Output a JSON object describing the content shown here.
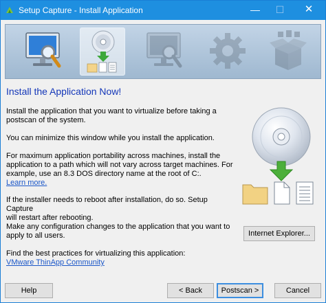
{
  "window": {
    "title": "Setup Capture - Install Application",
    "minimize_glyph": "—",
    "maximize_glyph": "☐",
    "close_glyph": "✕"
  },
  "wizard_steps": [
    {
      "icon": "monitor-search-icon",
      "state": "completed"
    },
    {
      "icon": "install-disc-icon",
      "state": "active"
    },
    {
      "icon": "monitor-search-icon",
      "state": "upcoming"
    },
    {
      "icon": "gear-icon",
      "state": "upcoming"
    },
    {
      "icon": "package-icon",
      "state": "upcoming"
    }
  ],
  "content": {
    "heading": "Install the Application Now!",
    "p1_line1": "Install the application that you want to virtualize before taking a",
    "p1_line2": "postscan of the system.",
    "p2": "You can minimize this window while you install the application.",
    "p3_line1": "For maximum application portability across machines, install the",
    "p3_line2": "application to a path which will not vary across target machines. For",
    "p3_line3": "example, use an 8.3 DOS directory name at the root of C:.",
    "learn_more_link": "Learn more.",
    "p4_line1": "If the installer needs to reboot after installation, do so. Setup Capture",
    "p4_line2": "will restart after rebooting.",
    "p5_line1": "Make any configuration changes to the application that you want to",
    "p5_line2": "apply to all users.",
    "p6": "Find the best practices for virtualizing this application:",
    "community_link": "VMware ThinApp Community"
  },
  "buttons": {
    "internet_explorer": "Internet Explorer...",
    "help": "Help",
    "back": "< Back",
    "next": "Postscan >",
    "cancel": "Cancel"
  },
  "colors": {
    "titlebar": "#1e8fe0",
    "heading": "#1336b8",
    "link": "#1a56c8",
    "arrow": "#4caf3a"
  }
}
